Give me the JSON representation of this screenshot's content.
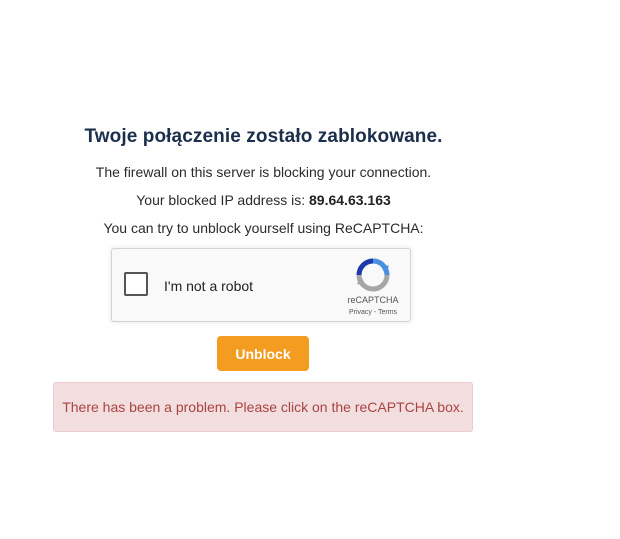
{
  "heading": "Twoje połączenie zostało zablokowane.",
  "firewall_text": "The firewall on this server is blocking your connection.",
  "ip_prefix": "Your blocked IP address is: ",
  "ip_address": "89.64.63.163",
  "unblock_hint": "You can try to unblock yourself using ReCAPTCHA:",
  "recaptcha": {
    "label": "I'm not a robot",
    "checked": false,
    "brand": "reCAPTCHA",
    "privacy": "Privacy",
    "separator": " - ",
    "terms": "Terms",
    "icon": "recaptcha-logo-icon"
  },
  "unblock_button": "Unblock",
  "error_message": "There has been a problem. Please click on the reCAPTCHA box.",
  "colors": {
    "heading": "#1b2e4b",
    "button": "#f39c1f",
    "alert_bg": "#f2dede",
    "alert_text": "#a94442",
    "recaptcha_blue": "#4a90e2",
    "recaptcha_gray": "#a6a6a6"
  }
}
